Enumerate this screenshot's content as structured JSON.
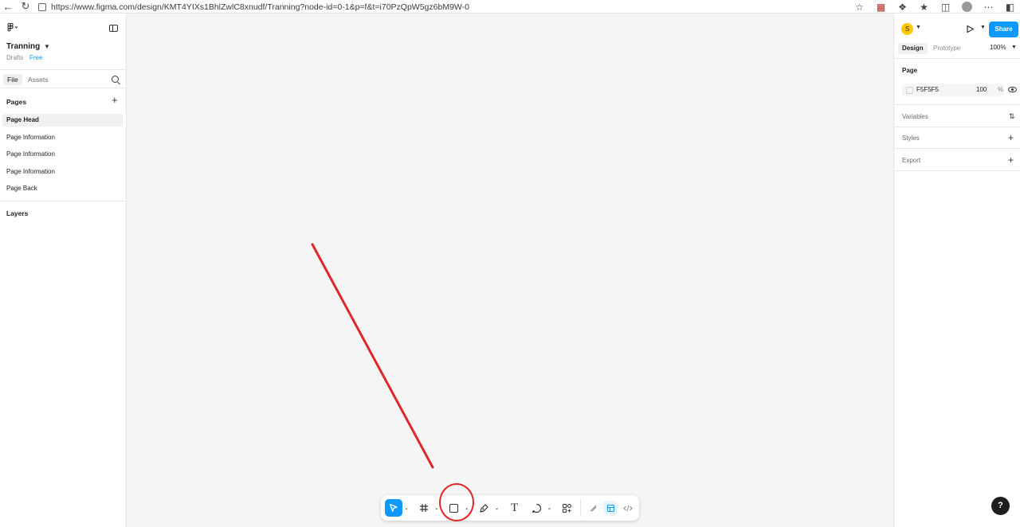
{
  "browser": {
    "url": "https://www.figma.com/design/KMT4YIXs1BhlZwlC8xnudf/Tranning?node-id=0-1&p=f&t=i70PzQpW5gz6bM9W-0"
  },
  "file": {
    "name": "Tranning",
    "location": "Drafts",
    "plan": "Free"
  },
  "left_tabs": [
    "File",
    "Assets"
  ],
  "pages": {
    "title": "Pages",
    "items": [
      "Page Head",
      "Page Information",
      "Page Information",
      "Page Information",
      "Page Back"
    ],
    "selected": "Page Head"
  },
  "layers": {
    "title": "Layers"
  },
  "toolbar": {
    "tools": [
      "move-tool",
      "frame-tool",
      "rectangle-tool",
      "pen-tool",
      "text-tool",
      "comment-tool",
      "actions-tool"
    ],
    "active_tool": "move-tool",
    "modes": [
      "draw-mode",
      "design-mode",
      "dev-mode"
    ],
    "active_mode": "design-mode"
  },
  "right_panel": {
    "user_initial": "S",
    "share_label": "Share",
    "tabs": [
      "Design",
      "Prototype"
    ],
    "active_tab": "Design",
    "zoom": "100%",
    "page_section": "Page",
    "page_color": "F5F5F5",
    "page_opacity": "100",
    "opacity_unit": "%",
    "variables": "Variables",
    "styles": "Styles",
    "export": "Export"
  },
  "help_label": "?",
  "colors": {
    "accent": "#0d99ff",
    "annotation": "#e0262b",
    "canvas": "#f5f5f5",
    "avatar": "#ffc700"
  }
}
